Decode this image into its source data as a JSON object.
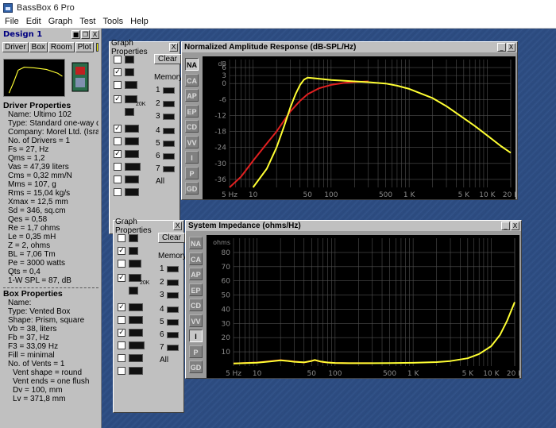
{
  "window": {
    "title": "BassBox 6 Pro"
  },
  "menu": [
    "File",
    "Edit",
    "Graph",
    "Test",
    "Tools",
    "Help"
  ],
  "design": {
    "title": "Design 1",
    "tabs": [
      "Driver",
      "Box",
      "Room",
      "Plot"
    ],
    "swatch_color": "#ffff00",
    "driver_heading": "Driver Properties",
    "driver_lines": [
      "Name: Ultimo 102",
      "Type: Standard one-way driver",
      "Company: Morel Ltd. (Israel)",
      "No. of Drivers = 1",
      "Fs = 27, Hz",
      "Qms = 1,2",
      "Vas = 47,39 liters",
      "Cms = 0,32 mm/N",
      "Mms = 107, g",
      "Rms = 15,04 kg/s",
      "Xmax = 12,5 mm",
      "Sd = 346, sq.cm",
      "Qes = 0,58",
      "Re = 1,7 ohms",
      "Le = 0,35 mH",
      "Z = 2, ohms",
      "BL = 7,06 Tm",
      "Pe = 3000 watts",
      "Qts = 0,4",
      "1-W SPL = 87, dB"
    ],
    "box_heading": "Box Properties",
    "box_lines": [
      "Name:",
      "Type: Vented Box",
      "Shape: Prism, square",
      "Vb = 38, liters",
      "Fb = 37, Hz",
      "F3 = 33,09 Hz",
      "Fill = minimal",
      "No. of Vents = 1"
    ],
    "vent_lines": [
      "Vent shape = round",
      "Vent ends = one flush",
      "Dv = 100, mm",
      "Lv = 371,8 mm"
    ]
  },
  "graph_properties": {
    "title": "Graph Properties",
    "close": "X",
    "clear": "Clear",
    "memory": "Memory",
    "memory_slots": [
      "1",
      "2",
      "3",
      "4",
      "5",
      "6",
      "7"
    ],
    "all": "All",
    "icon_20k": "20K"
  },
  "window_controls": {
    "minimize": "_",
    "close": "X"
  },
  "side_buttons": [
    "NA",
    "CA",
    "AP",
    "EP",
    "CD",
    "VV",
    "I",
    "P",
    "GD"
  ],
  "colors": {
    "yellow_trace": "#ffff33",
    "red_trace": "#e02020",
    "grid": "#505050",
    "plot_bg": "#000000"
  },
  "chart_data": [
    {
      "type": "line",
      "title": "Normalized Amplitude Response (dB-SPL/Hz)",
      "active_button": "NA",
      "x_scale": "log",
      "xlim": [
        5,
        20000
      ],
      "ylim": [
        -39,
        9
      ],
      "yunit": "dB",
      "xticks": [
        {
          "v": 5,
          "label": "5 Hz"
        },
        {
          "v": 10,
          "label": "10"
        },
        {
          "v": 50,
          "label": "50"
        },
        {
          "v": 100,
          "label": "100"
        },
        {
          "v": 500,
          "label": "500"
        },
        {
          "v": 1000,
          "label": "1 K"
        },
        {
          "v": 5000,
          "label": "5 K"
        },
        {
          "v": 10000,
          "label": "10 K"
        },
        {
          "v": 20000,
          "label": "20 K"
        }
      ],
      "yticks": [
        {
          "v": 6,
          "label": "6"
        },
        {
          "v": 3,
          "label": "3"
        },
        {
          "v": 0,
          "label": "0"
        },
        {
          "v": -6,
          "label": "-6"
        },
        {
          "v": -12,
          "label": "-12"
        },
        {
          "v": -18,
          "label": "-18"
        },
        {
          "v": -24,
          "label": "-24"
        },
        {
          "v": -30,
          "label": "-30"
        },
        {
          "v": -36,
          "label": "-36"
        }
      ],
      "series": [
        {
          "color": "#e02020",
          "x": [
            5,
            7,
            10,
            15,
            20,
            30,
            40,
            50,
            70,
            100,
            150,
            200,
            300
          ],
          "y": [
            -39,
            -35,
            -29,
            -22.5,
            -18,
            -10.5,
            -6.5,
            -4,
            -1.8,
            -0.5,
            0.3,
            0.6,
            0.8
          ]
        },
        {
          "color": "#ffff33",
          "x": [
            10,
            15,
            20,
            25,
            30,
            35,
            40,
            45,
            50,
            60,
            80,
            100,
            150,
            200,
            300,
            500,
            700,
            1000,
            2000,
            3000,
            5000,
            7000,
            10000,
            15000,
            20000
          ],
          "y": [
            -39,
            -32,
            -24,
            -16,
            -9,
            -4,
            -0.5,
            1.5,
            2.2,
            2.0,
            1.6,
            1.3,
            1.0,
            0.8,
            0.5,
            0,
            -0.8,
            -2,
            -5.5,
            -8.5,
            -13,
            -16,
            -19.5,
            -23.5,
            -26
          ]
        }
      ]
    },
    {
      "type": "line",
      "title": "System Impedance (ohms/Hz)",
      "active_button": "I",
      "x_scale": "log",
      "xlim": [
        5,
        20000
      ],
      "ylim": [
        0,
        90
      ],
      "yunit": "ohms",
      "xticks": [
        {
          "v": 5,
          "label": "5 Hz"
        },
        {
          "v": 10,
          "label": "10"
        },
        {
          "v": 50,
          "label": "50"
        },
        {
          "v": 100,
          "label": "100"
        },
        {
          "v": 500,
          "label": "500"
        },
        {
          "v": 1000,
          "label": "1 K"
        },
        {
          "v": 5000,
          "label": "5 K"
        },
        {
          "v": 10000,
          "label": "10 K"
        },
        {
          "v": 20000,
          "label": "20 K"
        }
      ],
      "yticks": [
        {
          "v": 80,
          "label": "80"
        },
        {
          "v": 70,
          "label": "70"
        },
        {
          "v": 60,
          "label": "60"
        },
        {
          "v": 50,
          "label": "50"
        },
        {
          "v": 40,
          "label": "40"
        },
        {
          "v": 30,
          "label": "30"
        },
        {
          "v": 20,
          "label": "20"
        },
        {
          "v": 10,
          "label": "10"
        }
      ],
      "series": [
        {
          "color": "#e02020",
          "x": [
            5,
            10,
            15,
            20,
            30,
            40,
            55,
            70,
            100,
            150,
            200,
            300
          ],
          "y": [
            1.8,
            2.5,
            3.5,
            4.2,
            3.2,
            2.5,
            4.2,
            2.8,
            2.2,
            2.0,
            2.0,
            2.0
          ]
        },
        {
          "color": "#ffff33",
          "x": [
            5,
            10,
            15,
            20,
            25,
            30,
            40,
            50,
            55,
            65,
            80,
            100,
            150,
            200,
            300,
            500,
            1000,
            2000,
            3000,
            5000,
            7000,
            10000,
            13000,
            16000,
            20000
          ],
          "y": [
            1.8,
            2.4,
            3.3,
            4.0,
            3.6,
            3.0,
            2.6,
            3.6,
            4.3,
            3.2,
            2.5,
            2.2,
            2.0,
            2.0,
            2.0,
            2.1,
            2.3,
            2.8,
            3.5,
            5.5,
            8.5,
            14,
            22,
            32,
            45
          ]
        }
      ]
    }
  ]
}
